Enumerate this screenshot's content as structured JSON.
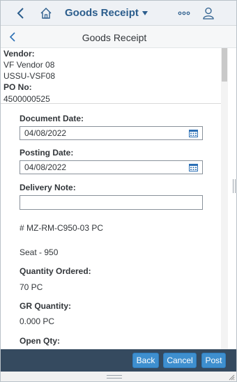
{
  "shell": {
    "title": "Goods Receipt",
    "icons": {
      "back": "back-chevron-icon",
      "home": "home-icon",
      "dropdown": "caret-down-icon",
      "more": "more-icon",
      "user": "user-icon"
    }
  },
  "page": {
    "title": "Goods Receipt"
  },
  "header": {
    "vendor_label": "Vendor:",
    "vendor_name": "VF Vendor 08",
    "vendor_id": "USSU-VSF08",
    "po_label": "PO No:",
    "po_number": "4500000525"
  },
  "form": {
    "document_date_label": "Document Date:",
    "document_date_value": "04/08/2022",
    "posting_date_label": "Posting Date:",
    "posting_date_value": "04/08/2022",
    "delivery_note_label": "Delivery Note:",
    "delivery_note_value": ""
  },
  "item": {
    "material": "# MZ-RM-C950-03 PC",
    "description": "Seat - 950",
    "qty_ordered_label": "Quantity Ordered:",
    "qty_ordered_value": "70 PC",
    "gr_qty_label": "GR Quantity:",
    "gr_qty_value": "0.000 PC",
    "open_qty_label": "Open Qty:"
  },
  "footer": {
    "back_label": "Back",
    "cancel_label": "Cancel",
    "post_label": "Post"
  },
  "colors": {
    "shell_bg": "#eef1f5",
    "title_blue": "#2b5d8c",
    "footer_bg": "#354a5f",
    "button_bg": "#3e8fcf"
  }
}
